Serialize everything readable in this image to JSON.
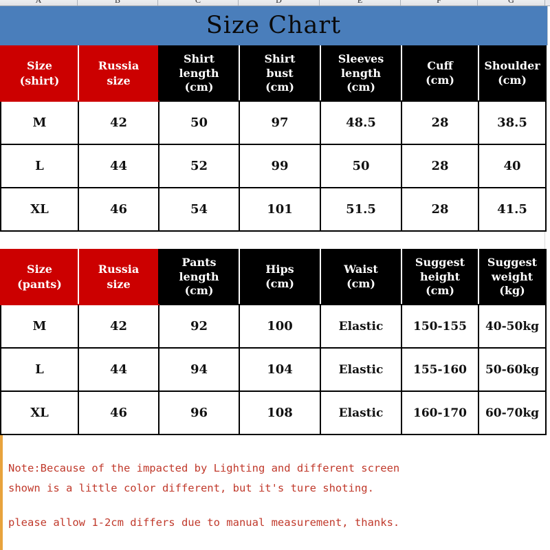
{
  "spreadsheet": {
    "column_letters": [
      "A",
      "B",
      "C",
      "D",
      "E",
      "F",
      "G"
    ]
  },
  "title": {
    "text": "Size Chart",
    "background_color": "#4a7ebb",
    "text_color": "#0a0a0a"
  },
  "colors": {
    "header_red": "#cc0000",
    "header_black": "#000000",
    "banner_blue": "#4a7ebb",
    "note_red": "#c0392b",
    "note_accent_bar": "#e8a33d"
  },
  "shirt_table": {
    "name": "shirt-size-table",
    "headers": [
      {
        "label": "Size\n(shirt)",
        "style": "red"
      },
      {
        "label": "Russia\nsize",
        "style": "red"
      },
      {
        "label": "Shirt\nlength\n(cm)",
        "style": "black"
      },
      {
        "label": "Shirt\nbust\n(cm)",
        "style": "black"
      },
      {
        "label": "Sleeves\nlength\n(cm)",
        "style": "black"
      },
      {
        "label": "Cuff\n(cm)",
        "style": "black"
      },
      {
        "label": "Shoulder\n(cm)",
        "style": "black"
      }
    ],
    "rows": [
      [
        "M",
        "42",
        "50",
        "97",
        "48.5",
        "28",
        "38.5"
      ],
      [
        "L",
        "44",
        "52",
        "99",
        "50",
        "28",
        "40"
      ],
      [
        "XL",
        "46",
        "54",
        "101",
        "51.5",
        "28",
        "41.5"
      ]
    ]
  },
  "pants_table": {
    "name": "pants-size-table",
    "headers": [
      {
        "label": "Size\n(pants)",
        "style": "red"
      },
      {
        "label": "Russia\nsize",
        "style": "red"
      },
      {
        "label": "Pants\nlength\n(cm)",
        "style": "black"
      },
      {
        "label": "Hips\n(cm)",
        "style": "black"
      },
      {
        "label": "Waist\n(cm)",
        "style": "black"
      },
      {
        "label": "Suggest\nheight\n(cm)",
        "style": "black"
      },
      {
        "label": "Suggest\nweight\n(kg)",
        "style": "black"
      }
    ],
    "rows": [
      [
        "M",
        "42",
        "92",
        "100",
        "Elastic",
        "150-155",
        "40-50kg"
      ],
      [
        "L",
        "44",
        "94",
        "104",
        "Elastic",
        "155-160",
        "50-60kg"
      ],
      [
        "XL",
        "46",
        "96",
        "108",
        "Elastic",
        "160-170",
        "60-70kg"
      ]
    ]
  },
  "note": {
    "lines": [
      "Note:Because of the impacted by Lighting and different screen",
      "shown is a little color different, but it's ture shoting.",
      "please allow 1-2cm differs due to manual measurement, thanks."
    ]
  }
}
